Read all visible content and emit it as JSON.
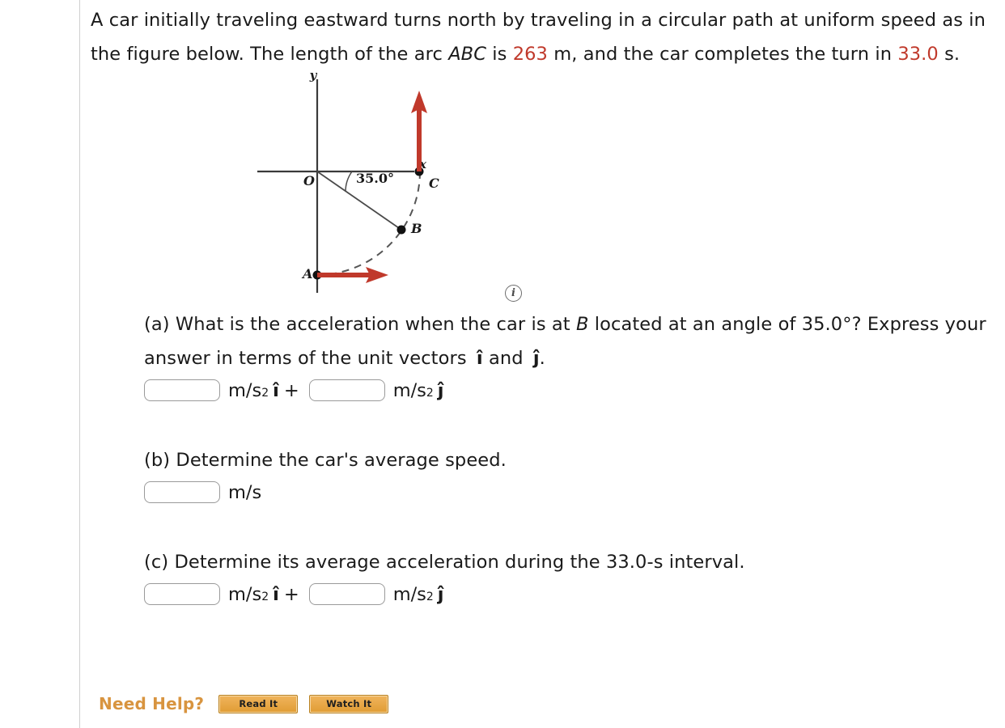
{
  "problem": {
    "stem_part1": "A car initially traveling eastward turns north by traveling in a circular path at uniform speed as in the figure below. The length of the arc ",
    "stem_arc_label": "ABC",
    "stem_part2": " is ",
    "arc_length": "263",
    "stem_part3": " m, and the car completes the turn in ",
    "time": "33.0",
    "stem_part4": " s."
  },
  "figure": {
    "axis_x_label": "x",
    "axis_y_label": "y",
    "origin_label": "O",
    "angle_label": "35.0°",
    "point_a_label": "A",
    "point_b_label": "B",
    "point_c_label": "C",
    "info_icon": "i",
    "colors": {
      "vector_red": "#c0392b",
      "axis": "#3a3a3a",
      "dashed_arc": "#555555"
    }
  },
  "parts": {
    "a": {
      "label": "(a) What is the acceleration when the car is at ",
      "italic_b": "B",
      "label2": " located at an angle of 35.0°? Express your answer in terms of the unit vectors ",
      "unit_i": "î",
      "and": " and ",
      "unit_j": "ĵ",
      "period": ".",
      "input1_value": "",
      "input1_placeholder": "",
      "unit1_base": "m/s",
      "unit1_exp": "2",
      "unit1_vec": "î",
      "plus": "+",
      "input2_value": "",
      "input2_placeholder": "",
      "unit2_base": "m/s",
      "unit2_exp": "2",
      "unit2_vec": "ĵ"
    },
    "b": {
      "label": "(b) Determine the car's average speed.",
      "input1_value": "",
      "input1_placeholder": "",
      "unit1": "m/s"
    },
    "c": {
      "label": "(c) Determine its average acceleration during the 33.0-s interval.",
      "input1_value": "",
      "input1_placeholder": "",
      "unit1_base": "m/s",
      "unit1_exp": "2",
      "unit1_vec": "î",
      "plus": "+",
      "input2_value": "",
      "input2_placeholder": "",
      "unit2_base": "m/s",
      "unit2_exp": "2",
      "unit2_vec": "ĵ"
    }
  },
  "help": {
    "label": "Need Help?",
    "read_it": "Read It",
    "watch_it": "Watch It"
  }
}
